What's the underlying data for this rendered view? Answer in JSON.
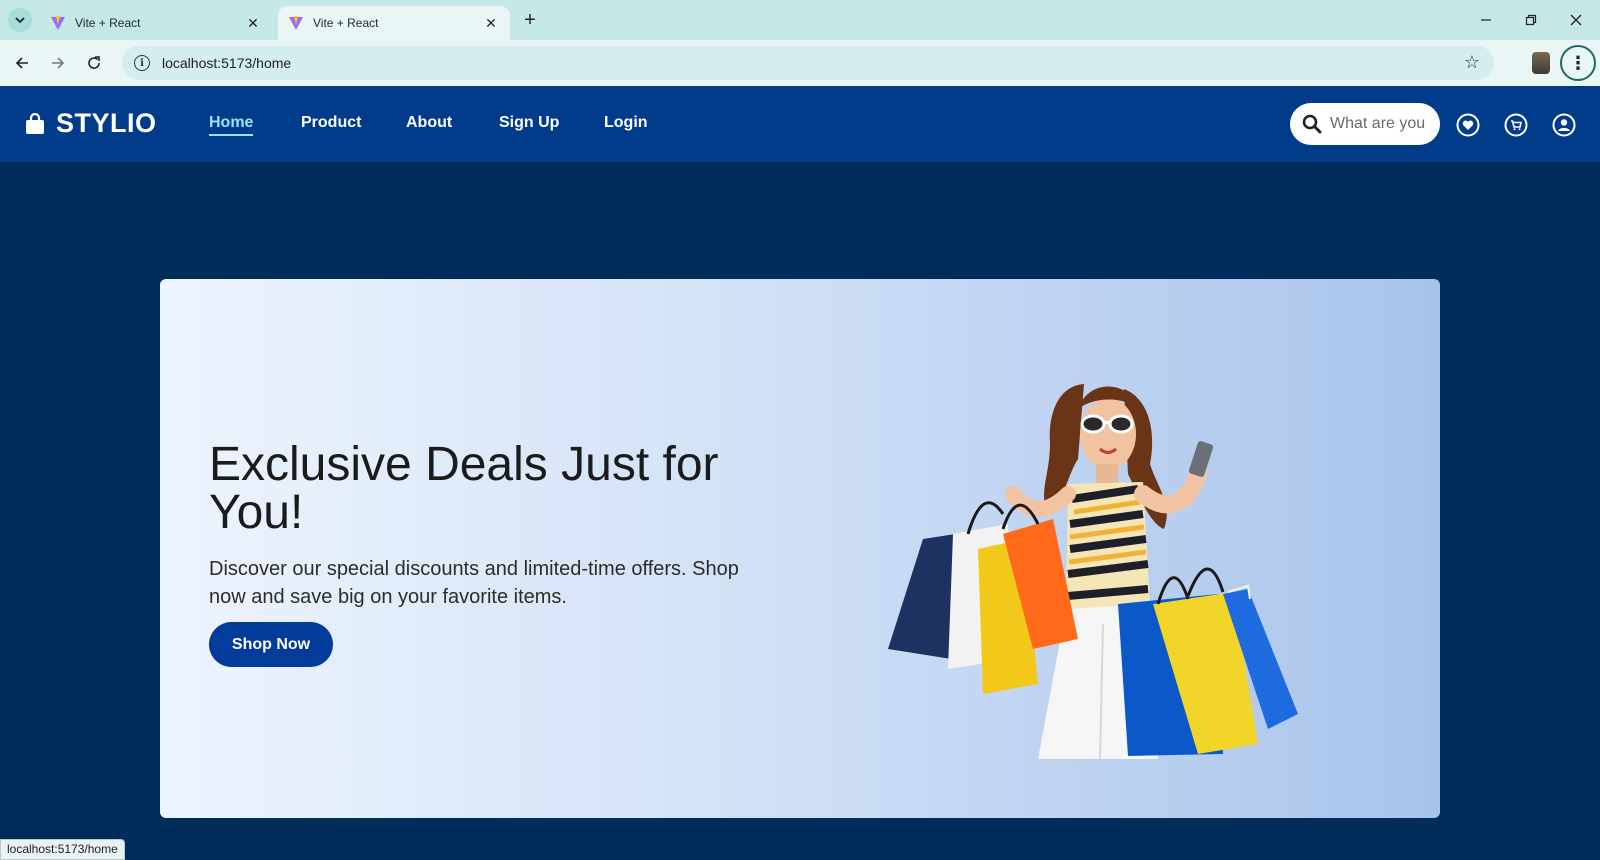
{
  "browser": {
    "tabs": [
      {
        "title": "Vite + React",
        "active": false
      },
      {
        "title": "Vite + React",
        "active": true
      }
    ],
    "url": "localhost:5173/home",
    "status_url": "localhost:5173/home"
  },
  "site": {
    "brand": "STYLIO",
    "nav": [
      {
        "label": "Home",
        "active": true
      },
      {
        "label": "Product",
        "active": false
      },
      {
        "label": "About",
        "active": false
      },
      {
        "label": "Sign Up",
        "active": false
      },
      {
        "label": "Login",
        "active": false
      }
    ],
    "search_placeholder": "What are you looking for?",
    "icons": [
      "search-icon",
      "heart-icon",
      "cart-icon",
      "user-icon"
    ],
    "colors": {
      "header": "#033b8b",
      "page": "#022c5a",
      "button": "#033b9b",
      "active_link": "#9fe0ff"
    }
  },
  "hero": {
    "title": "Exclusive Deals Just for You!",
    "description": "Discover our special discounts and limited-time offers. Shop now and save big on your favorite items.",
    "cta": "Shop Now"
  }
}
